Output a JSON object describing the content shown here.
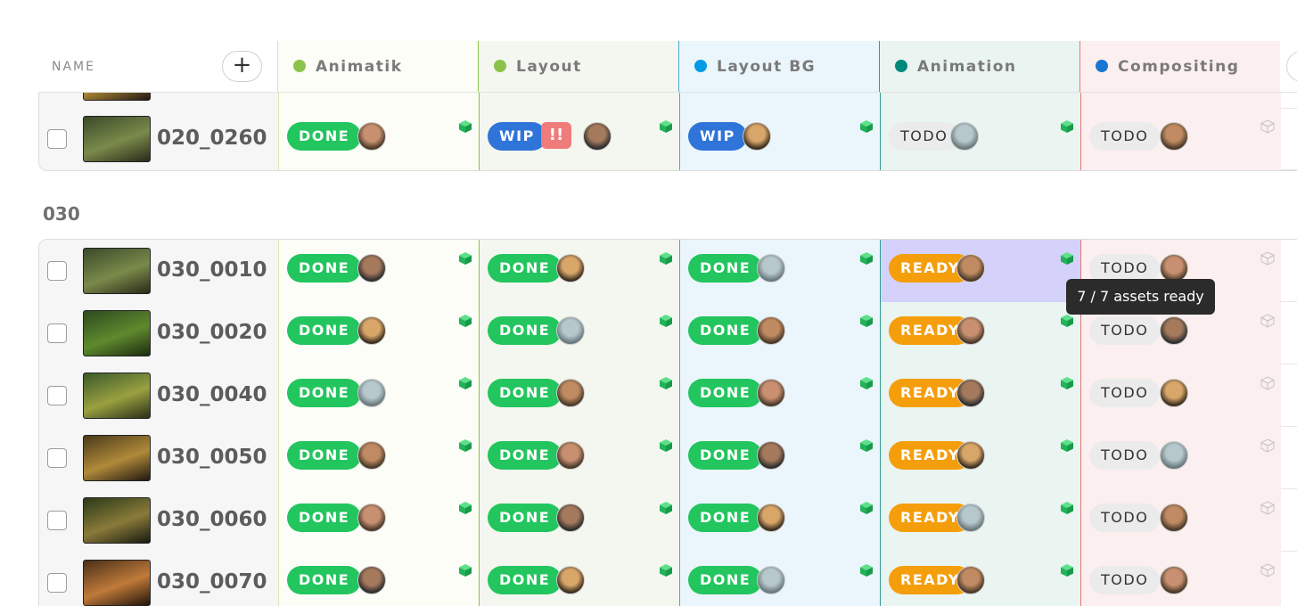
{
  "header": {
    "name_label": "NAME",
    "add_label": "+",
    "columns": [
      {
        "label": "Animatik",
        "color": "#8bc34a"
      },
      {
        "label": "Layout",
        "color": "#8bc34a"
      },
      {
        "label": "Layout BG",
        "color": "#039be5"
      },
      {
        "label": "Animation",
        "color": "#00897b"
      },
      {
        "label": "Compositing",
        "color": "#1976d2"
      }
    ]
  },
  "groups": [
    {
      "title": "",
      "rows": [
        {
          "name": "020_0260",
          "cells": [
            {
              "status": "DONE",
              "kind": "done"
            },
            {
              "status": "WIP",
              "kind": "wip",
              "priority": "!!"
            },
            {
              "status": "WIP",
              "kind": "wip"
            },
            {
              "status": "TODO",
              "kind": "todo"
            },
            {
              "status": "TODO",
              "kind": "todo"
            }
          ]
        }
      ]
    },
    {
      "title": "030",
      "rows": [
        {
          "name": "030_0010",
          "cells": [
            {
              "status": "DONE",
              "kind": "done"
            },
            {
              "status": "DONE",
              "kind": "done"
            },
            {
              "status": "DONE",
              "kind": "done"
            },
            {
              "status": "READY",
              "kind": "ready"
            },
            {
              "status": "TODO",
              "kind": "todo"
            }
          ]
        },
        {
          "name": "030_0020",
          "cells": [
            {
              "status": "DONE",
              "kind": "done"
            },
            {
              "status": "DONE",
              "kind": "done"
            },
            {
              "status": "DONE",
              "kind": "done"
            },
            {
              "status": "READY",
              "kind": "ready"
            },
            {
              "status": "TODO",
              "kind": "todo"
            }
          ]
        },
        {
          "name": "030_0040",
          "cells": [
            {
              "status": "DONE",
              "kind": "done"
            },
            {
              "status": "DONE",
              "kind": "done"
            },
            {
              "status": "DONE",
              "kind": "done"
            },
            {
              "status": "READY",
              "kind": "ready"
            },
            {
              "status": "TODO",
              "kind": "todo"
            }
          ]
        },
        {
          "name": "030_0050",
          "cells": [
            {
              "status": "DONE",
              "kind": "done"
            },
            {
              "status": "DONE",
              "kind": "done"
            },
            {
              "status": "DONE",
              "kind": "done"
            },
            {
              "status": "READY",
              "kind": "ready"
            },
            {
              "status": "TODO",
              "kind": "todo"
            }
          ]
        },
        {
          "name": "030_0060",
          "cells": [
            {
              "status": "DONE",
              "kind": "done"
            },
            {
              "status": "DONE",
              "kind": "done"
            },
            {
              "status": "DONE",
              "kind": "done"
            },
            {
              "status": "READY",
              "kind": "ready"
            },
            {
              "status": "TODO",
              "kind": "todo"
            }
          ]
        },
        {
          "name": "030_0070",
          "cells": [
            {
              "status": "DONE",
              "kind": "done"
            },
            {
              "status": "DONE",
              "kind": "done"
            },
            {
              "status": "DONE",
              "kind": "done"
            },
            {
              "status": "READY",
              "kind": "ready"
            },
            {
              "status": "TODO",
              "kind": "todo"
            }
          ]
        }
      ]
    }
  ],
  "tooltip": {
    "text": "7 / 7 assets ready"
  },
  "icons": {
    "asset": "cube-icon",
    "asset_empty": "cube-outline-icon",
    "priority": "priority-badge"
  }
}
